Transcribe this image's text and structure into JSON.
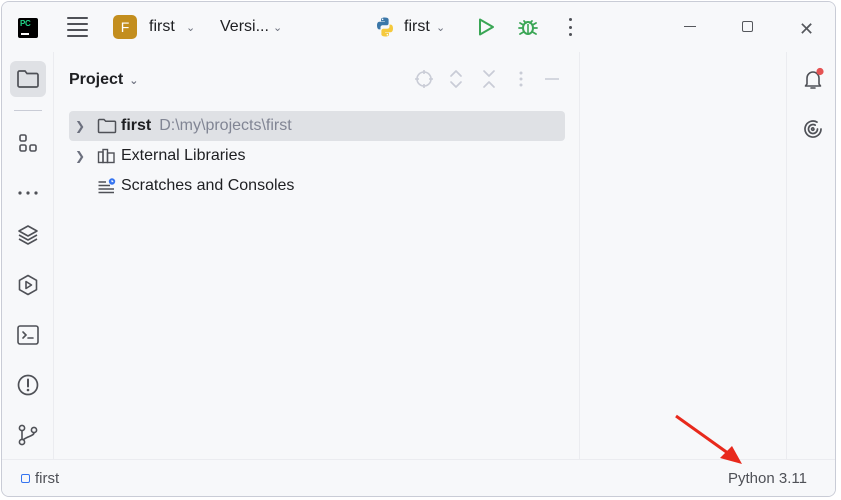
{
  "titlebar": {
    "app_logo_text": "PC",
    "project_badge": "F",
    "project_name": "first",
    "vcs_label": "Versi...",
    "run_config": "first"
  },
  "left_tools": [
    "project",
    "structure",
    "more",
    "layers",
    "services",
    "terminal",
    "problems",
    "git"
  ],
  "panel": {
    "title": "Project",
    "tree": [
      {
        "label": "first",
        "path": "D:\\my\\projects\\first",
        "selected": true
      },
      {
        "label": "External Libraries"
      },
      {
        "label": "Scratches and Consoles"
      }
    ]
  },
  "statusbar": {
    "breadcrumb": "first",
    "interpreter": "Python 3.11"
  },
  "colors": {
    "accent": "#3574f0",
    "badge": "#c38e1e",
    "run_green": "#3aa655",
    "annotation_red": "#e8291c",
    "notification_dot": "#e55353"
  }
}
